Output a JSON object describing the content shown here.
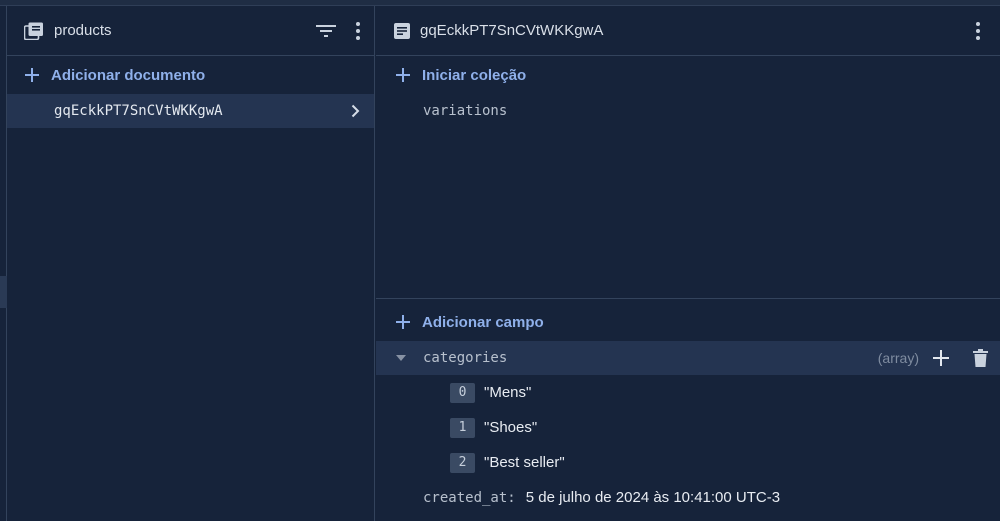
{
  "collection_panel": {
    "title": "products",
    "add_document_label": "Adicionar documento",
    "documents": [
      {
        "id": "gqEckkPT7SnCVtWKKgwA"
      }
    ]
  },
  "document_panel": {
    "title": "gqEckkPT7SnCVtWKKgwA",
    "start_collection_label": "Iniciar coleção",
    "subcollections": [
      {
        "name": "variations"
      }
    ],
    "add_field_label": "Adicionar campo",
    "fields": {
      "categories": {
        "key": "categories",
        "type": "(array)",
        "items": [
          {
            "index": "0",
            "value": "\"Mens\""
          },
          {
            "index": "1",
            "value": "\"Shoes\""
          },
          {
            "index": "2",
            "value": "\"Best seller\""
          }
        ]
      },
      "created_at": {
        "key": "created_at:",
        "value": "5 de julho de 2024 às 10:41:00 UTC-3"
      }
    }
  },
  "colors": {
    "background": "#16233a",
    "selected_row": "#243451",
    "accent": "#8fb0ea",
    "border": "#33435c"
  },
  "icons": [
    "collection-icon",
    "filter-icon",
    "more-vert-icon",
    "document-icon",
    "plus-icon",
    "chevron-right-icon",
    "caret-down-icon",
    "trash-icon"
  ]
}
